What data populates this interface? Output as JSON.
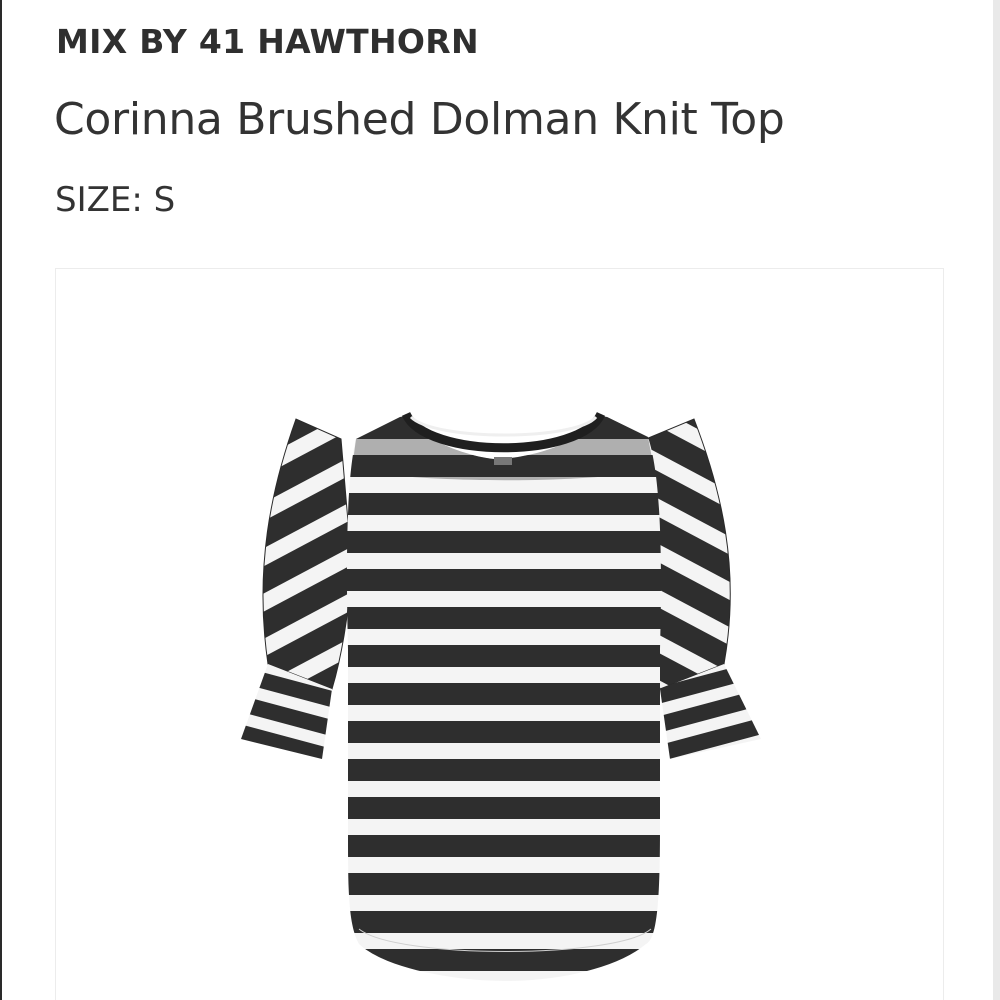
{
  "product": {
    "brand": "MIX BY 41 HAWTHORN",
    "name": "Corinna Brushed Dolman Knit Top",
    "size_label": "SIZE: S"
  },
  "image": {
    "icon": "striped-knit-top-photo",
    "stripe_colors": {
      "dark": "#2e2e2e",
      "light": "#f4f4f4"
    }
  }
}
